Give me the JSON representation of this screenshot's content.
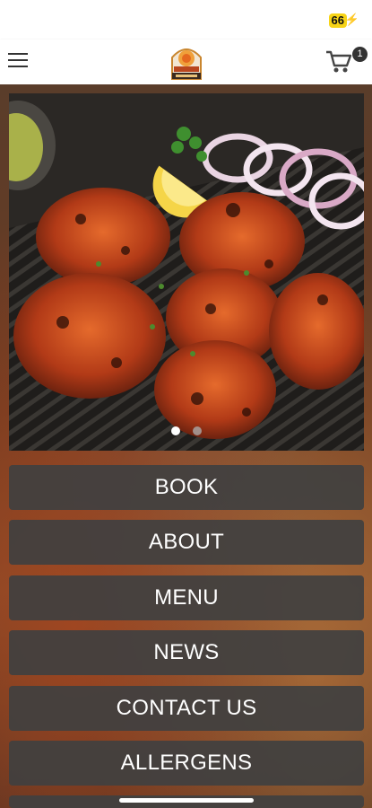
{
  "status_bar": {
    "battery": "66"
  },
  "header": {
    "menu_icon": "hamburger-icon",
    "logo": "restaurant-logo",
    "cart_icon": "cart-icon",
    "cart_count": "1"
  },
  "carousel": {
    "image": "grilled-chicken-tikka-photo",
    "dots": [
      {
        "active": true
      },
      {
        "active": false
      }
    ]
  },
  "menu": {
    "items": [
      {
        "label": "BOOK"
      },
      {
        "label": "ABOUT"
      },
      {
        "label": "MENU"
      },
      {
        "label": "NEWS"
      },
      {
        "label": "CONTACT US"
      },
      {
        "label": "ALLERGENS"
      }
    ]
  },
  "colors": {
    "button_bg": "#404040",
    "button_text": "#ffffff",
    "battery": "#f7d417"
  }
}
